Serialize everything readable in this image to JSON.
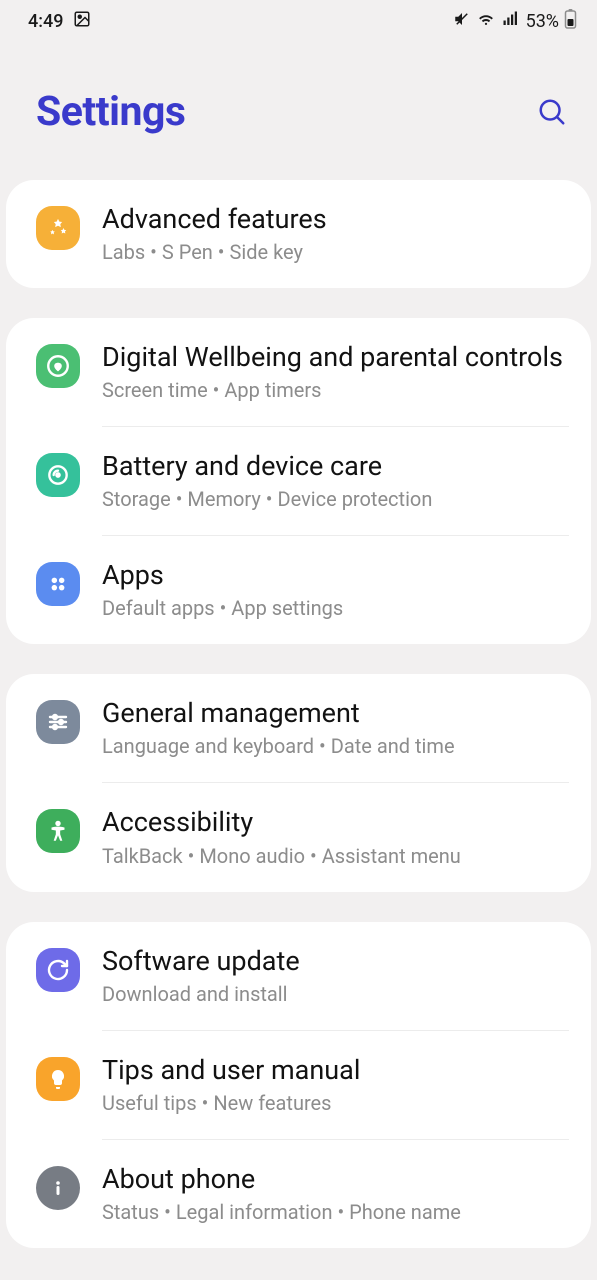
{
  "status": {
    "time": "4:49",
    "battery": "53%"
  },
  "header": {
    "title": "Settings"
  },
  "groups": [
    {
      "items": [
        {
          "title": "Advanced features",
          "sub": "Labs  •  S Pen  •  Side key"
        }
      ]
    },
    {
      "items": [
        {
          "title": "Digital Wellbeing and parental controls",
          "sub": "Screen time  •  App timers"
        },
        {
          "title": "Battery and device care",
          "sub": "Storage  •  Memory  •  Device protection"
        },
        {
          "title": "Apps",
          "sub": "Default apps  •  App settings"
        }
      ]
    },
    {
      "items": [
        {
          "title": "General management",
          "sub": "Language and keyboard  •  Date and time"
        },
        {
          "title": "Accessibility",
          "sub": "TalkBack  •  Mono audio  •  Assistant menu"
        }
      ]
    },
    {
      "items": [
        {
          "title": "Software update",
          "sub": "Download and install"
        },
        {
          "title": "Tips and user manual",
          "sub": "Useful tips  •  New features"
        },
        {
          "title": "About phone",
          "sub": "Status  •  Legal information  •  Phone name"
        }
      ]
    }
  ]
}
